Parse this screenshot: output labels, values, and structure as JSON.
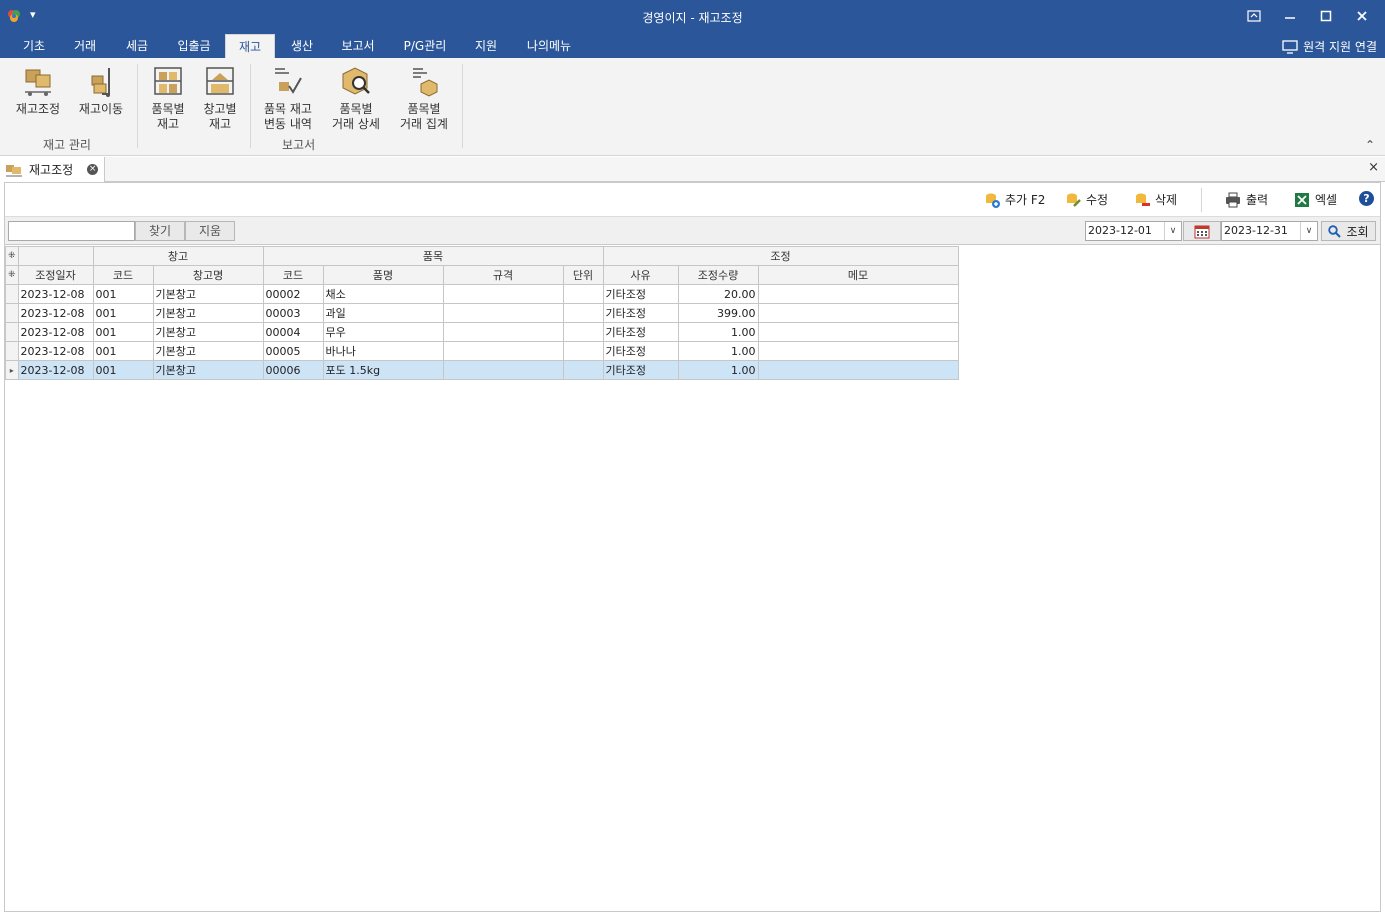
{
  "window": {
    "title": "경영이지 - 재고조정",
    "qat_symbol": "▾",
    "controls": {
      "restore": "⧉",
      "minimize": "—",
      "maximize": "☐",
      "close": "✕"
    }
  },
  "ribbon_tabs": [
    "기초",
    "거래",
    "세금",
    "입출금",
    "재고",
    "생산",
    "보고서",
    "P/G관리",
    "지원",
    "나의메뉴"
  ],
  "active_tab": "재고",
  "remote_support": "원격 지원 연결",
  "ribbon": {
    "groups": [
      {
        "label": "재고 관리",
        "items": [
          "재고조정",
          "재고이동"
        ]
      },
      {
        "label": "보고서",
        "items": [
          "품목별\n재고",
          "창고별\n재고",
          "품목 재고\n변동 내역",
          "품목별\n거래 상세",
          "품목별\n거래 집계"
        ]
      }
    ],
    "collapse_symbol": "⌃"
  },
  "doc_tab": {
    "label": "재고조정",
    "close": "×"
  },
  "close_all_symbol": "×",
  "toolbar": {
    "add": "추가 F2",
    "edit": "수정",
    "delete": "삭제",
    "print": "출력",
    "excel": "엑셀",
    "help": "?"
  },
  "filter": {
    "search_value": "",
    "find": "찾기",
    "clear": "지움",
    "date_from": "2023-12-01",
    "date_to": "2023-12-31",
    "dropdown": "∨",
    "query": "조회"
  },
  "grid": {
    "band_marker": "⁜",
    "bands": [
      "창고",
      "품목",
      "조정"
    ],
    "columns": [
      "조정일자",
      "코드",
      "창고명",
      "코드",
      "품명",
      "규격",
      "단위",
      "사유",
      "조정수량",
      "메모"
    ],
    "selected_marker": "▸",
    "rows": [
      [
        "2023-12-08",
        "001",
        "기본창고",
        "00002",
        "채소",
        "",
        "",
        "기타조정",
        "20.00",
        ""
      ],
      [
        "2023-12-08",
        "001",
        "기본창고",
        "00003",
        "과일",
        "",
        "",
        "기타조정",
        "399.00",
        ""
      ],
      [
        "2023-12-08",
        "001",
        "기본창고",
        "00004",
        "무우",
        "",
        "",
        "기타조정",
        "1.00",
        ""
      ],
      [
        "2023-12-08",
        "001",
        "기본창고",
        "00005",
        "바나나",
        "",
        "",
        "기타조정",
        "1.00",
        ""
      ],
      [
        "2023-12-08",
        "001",
        "기본창고",
        "00006",
        "포도 1.5kg",
        "",
        "",
        "기타조정",
        "1.00",
        ""
      ]
    ],
    "selected_row": 4
  },
  "colors": {
    "brand": "#2b579a",
    "selection": "#cde4f7"
  }
}
